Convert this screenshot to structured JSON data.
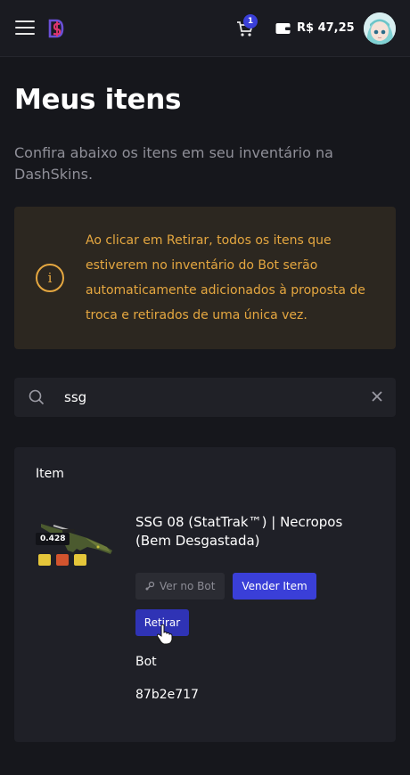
{
  "header": {
    "cart_count": "1",
    "balance": "R$ 47,25"
  },
  "page": {
    "title": "Meus itens",
    "subtitle": "Confira abaixo os itens em seu inventário na DashSkins."
  },
  "notice": {
    "icon_text": "i",
    "text": "Ao clicar em Retirar, todos os itens que estiverem no inventário do Bot serão automaticamente adicionados à proposta de troca e retirados de uma única vez."
  },
  "search": {
    "value": "ssg"
  },
  "items_table": {
    "column_label": "Item",
    "items": [
      {
        "float": "0.428",
        "name": "SSG 08 (StatTrak™) | Necropos (Bem Desgastada)",
        "view_bot_label": "Ver no Bot",
        "sell_label": "Vender Item",
        "withdraw_label": "Retirar",
        "bot_label": "Bot",
        "bot_id": "87b2e717"
      }
    ]
  },
  "colors": {
    "accent": "#3a3fd8",
    "warning": "#e5a740",
    "background": "#16171c"
  }
}
